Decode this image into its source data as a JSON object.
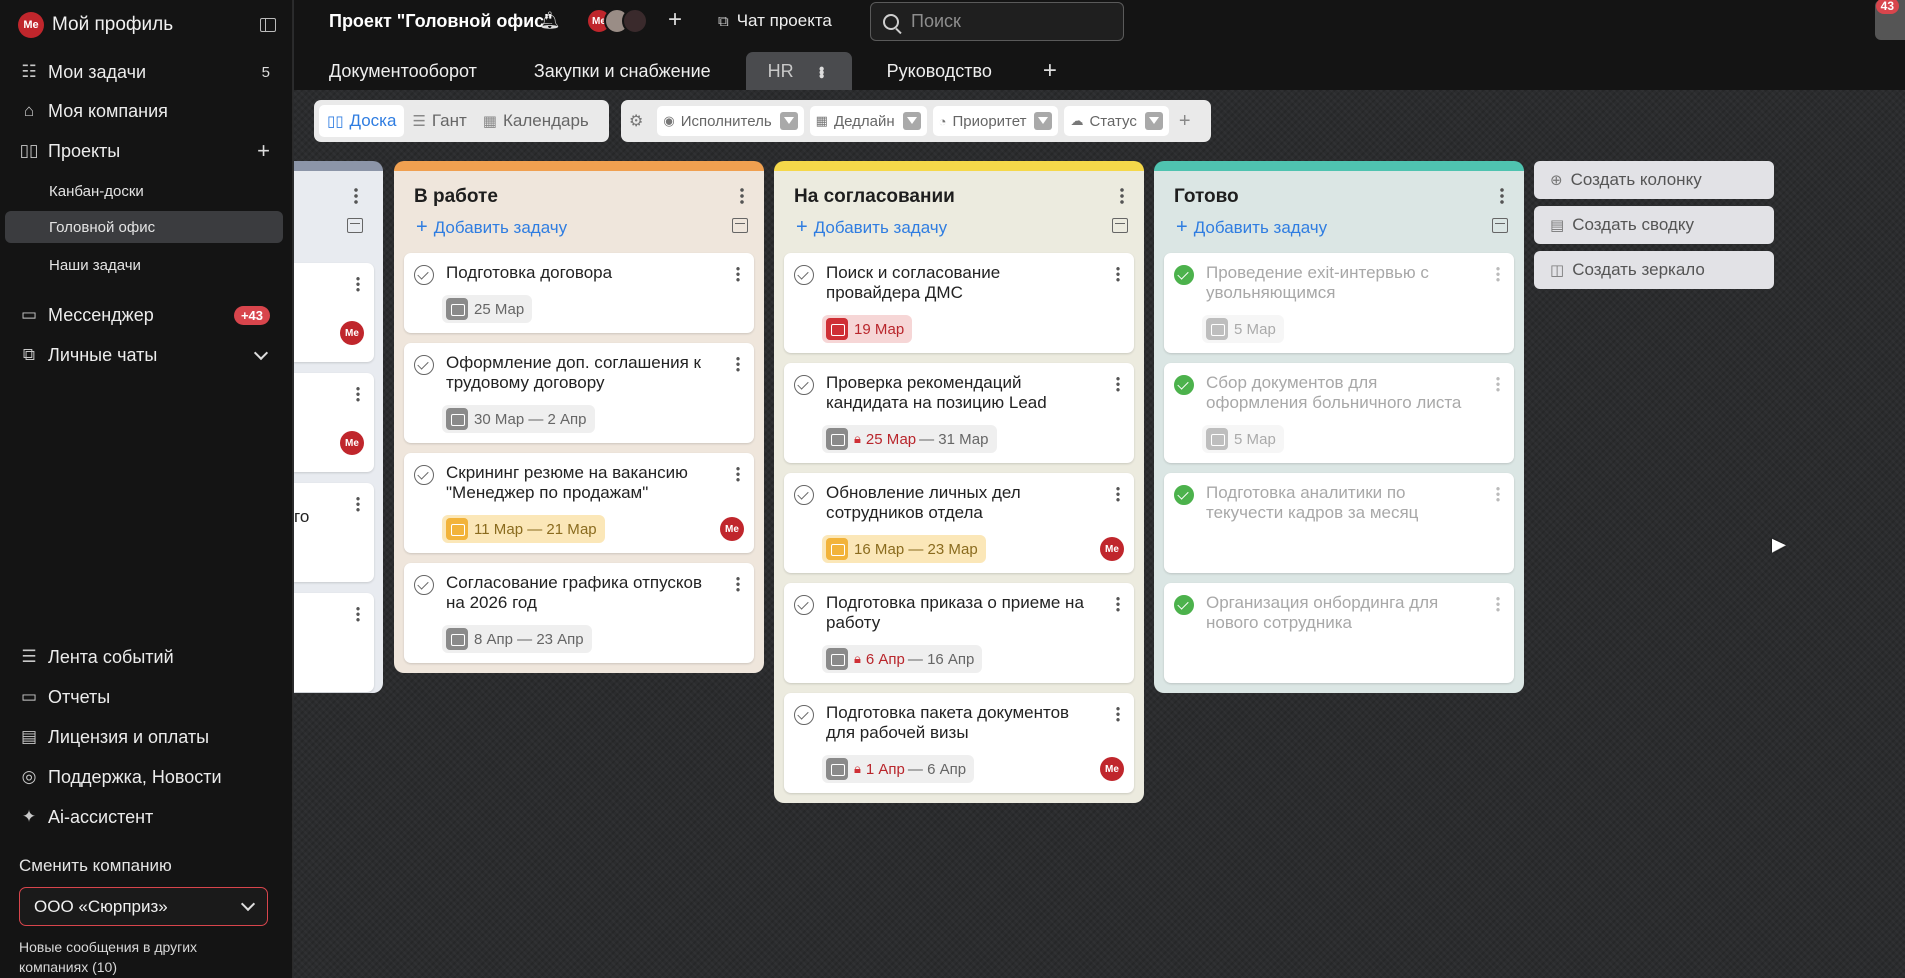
{
  "sidebar": {
    "profile_name": "Мой профиль",
    "avatar_initials": "Me",
    "my_tasks": {
      "label": "Мои задачи",
      "count": "5"
    },
    "my_company": "Моя компания",
    "projects": "Проекты",
    "project_list": [
      "Канбан-доски",
      "Головной офис",
      "Наши задачи"
    ],
    "messenger": {
      "label": "Мессенджер",
      "badge": "+43"
    },
    "personal_chats": "Личные чаты",
    "bottom": [
      "Лента событий",
      "Отчеты",
      "Лицензия и оплаты",
      "Поддержка, Новости",
      "Ai-ассистент"
    ],
    "switch_company_label": "Сменить компанию",
    "company": "ООО «Сюрприз»",
    "new_messages": "Новые сообщения в других компаниях (10)"
  },
  "header": {
    "project_title": "Проект \"Головной офис\"",
    "avatar_initials": "Me",
    "chat_label": "Чат проекта",
    "search_placeholder": "Поиск",
    "notify_count": "43",
    "tabs": [
      "Документооборот",
      "Закупки и снабжение",
      "HR",
      "Руководство"
    ],
    "active_tab": "HR"
  },
  "toolbar": {
    "views": [
      "Доска",
      "Гант",
      "Календарь"
    ],
    "active_view": "Доска",
    "filters": [
      "Исполнитель",
      "Дедлайн",
      "Приоритет",
      "Статус"
    ]
  },
  "colors": {
    "accent": "#2f7de1",
    "danger": "#d8454c",
    "col_progress": "#f0a050",
    "col_review": "#f5d84a",
    "col_done": "#4fc3b0",
    "col_left": "#8c95a8"
  },
  "columns": {
    "left": {
      "partial_text": "го"
    },
    "in_progress": {
      "title": "В работе",
      "add": "Добавить задачу",
      "cards": [
        {
          "title": "Подготовка договора",
          "date": "25 Мар"
        },
        {
          "title": "Оформление доп. соглашения к трудовому договору",
          "date": "30 Мар — 2 Апр"
        },
        {
          "title": "Скрининг резюме на вакансию \"Менеджер по продажам\"",
          "date": "11 Мар — 21 Мар"
        },
        {
          "title": "Согласование графика отпусков на 2026 год",
          "date": "8 Апр — 23 Апр"
        }
      ]
    },
    "review": {
      "title": "На согласовании",
      "add": "Добавить задачу",
      "cards": [
        {
          "title": "Поиск и согласование провайдера ДМС",
          "date": "19 Мар"
        },
        {
          "title": "Проверка рекомендаций кандидата на позицию Lead",
          "date_start": "25 Мар",
          "date_end": "— 31 Мар"
        },
        {
          "title": "Обновление личных дел сотрудников отдела",
          "date": "16 Мар — 23 Мар"
        },
        {
          "title": "Подготовка приказа о приеме на работу",
          "date_start": "6 Апр",
          "date_end": "— 16 Апр"
        },
        {
          "title": "Подготовка пакета документов для рабочей визы",
          "date_start": "1 Апр",
          "date_end": "— 6 Апр"
        }
      ]
    },
    "done": {
      "title": "Готово",
      "add": "Добавить задачу",
      "cards": [
        {
          "title": "Проведение exit-интервью с увольняющимся",
          "date": "5 Мар"
        },
        {
          "title": "Сбор документов для оформления больничного листа",
          "date": "5 Мар"
        },
        {
          "title": "Подготовка аналитики по текучести кадров за месяц"
        },
        {
          "title": "Организация онбординга для нового сотрудника"
        }
      ]
    }
  },
  "actions": [
    "Создать колонку",
    "Создать сводку",
    "Создать зеркало"
  ]
}
